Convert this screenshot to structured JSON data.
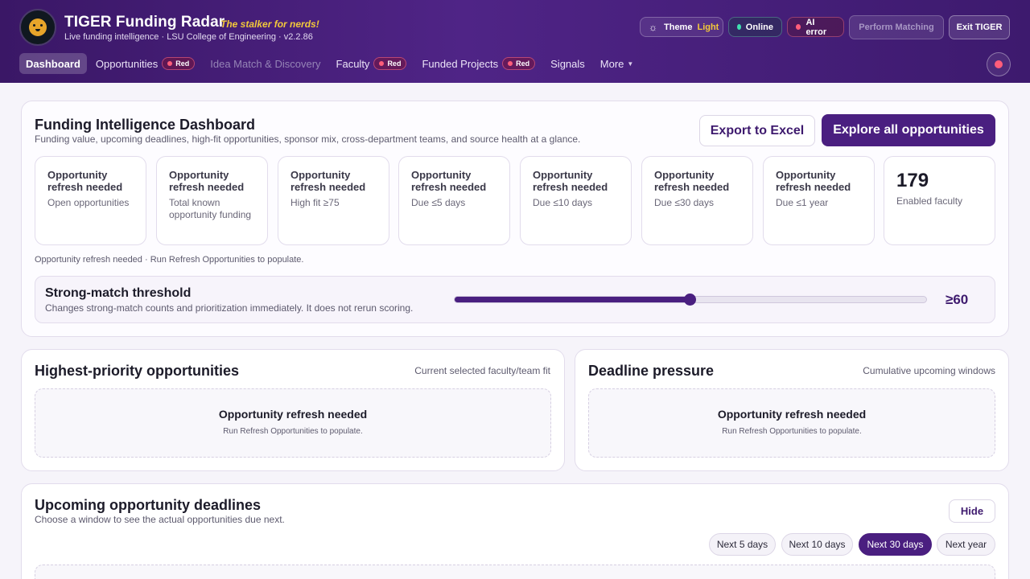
{
  "header": {
    "title": "TIGER Funding Radar",
    "tagline": "The stalker for nerds!",
    "subtitle": "Live funding intelligence · LSU College of Engineering · v2.2.86",
    "theme_label": "Theme",
    "theme_value": "Light",
    "online_label": "Online",
    "ai_status": "AI error",
    "perform_label": "Perform Matching",
    "exit_label": "Exit TIGER"
  },
  "nav": {
    "items": [
      {
        "label": "Dashboard"
      },
      {
        "label": "Opportunities",
        "badge": "Red"
      },
      {
        "label": "Idea Match & Discovery"
      },
      {
        "label": "Faculty",
        "badge": "Red"
      },
      {
        "label": "Funded Projects",
        "badge": "Red"
      },
      {
        "label": "Signals"
      },
      {
        "label": "More"
      }
    ]
  },
  "dashboard": {
    "title": "Funding Intelligence Dashboard",
    "description": "Funding value, upcoming deadlines, high-fit opportunities, sponsor mix, cross-department teams, and source health at a glance.",
    "export_label": "Export to Excel",
    "explore_label": "Explore all opportunities",
    "stats": [
      {
        "value": "Opportunity refresh needed",
        "label": "Open opportunities"
      },
      {
        "value": "Opportunity refresh needed",
        "label": "Total known opportunity funding"
      },
      {
        "value": "Opportunity refresh needed",
        "label": "High fit ≥75"
      },
      {
        "value": "Opportunity refresh needed",
        "label": "Due ≤5 days"
      },
      {
        "value": "Opportunity refresh needed",
        "label": "Due ≤10 days"
      },
      {
        "value": "Opportunity refresh needed",
        "label": "Due ≤30 days"
      },
      {
        "value": "Opportunity refresh needed",
        "label": "Due ≤1 year"
      },
      {
        "value": "179",
        "label": "Enabled faculty"
      }
    ],
    "note": "Opportunity refresh needed · Run Refresh Opportunities to populate.",
    "threshold": {
      "title": "Strong-match threshold",
      "description": "Changes strong-match counts and prioritization immediately. It does not rerun scoring.",
      "value": 60,
      "value_label": "≥60"
    }
  },
  "priority": {
    "title": "Highest-priority opportunities",
    "side_note": "Current selected faculty/team fit",
    "empty_title": "Opportunity refresh needed",
    "empty_desc": "Run Refresh Opportunities to populate."
  },
  "deadline": {
    "title": "Deadline pressure",
    "side_note": "Cumulative upcoming windows",
    "empty_title": "Opportunity refresh needed",
    "empty_desc": "Run Refresh Opportunities to populate."
  },
  "upcoming": {
    "title": "Upcoming opportunity deadlines",
    "description": "Choose a window to see the actual opportunities due next.",
    "hide_label": "Hide",
    "ranges": [
      "Next 5 days",
      "Next 10 days",
      "Next 30 days",
      "Next year"
    ],
    "selected_range": "Next 30 days"
  },
  "colors": {
    "brand_purple": "#4a1f80",
    "accent_yellow": "#f3c93a",
    "status_red": "#ff5d7a",
    "status_green": "#3fe0b0"
  }
}
